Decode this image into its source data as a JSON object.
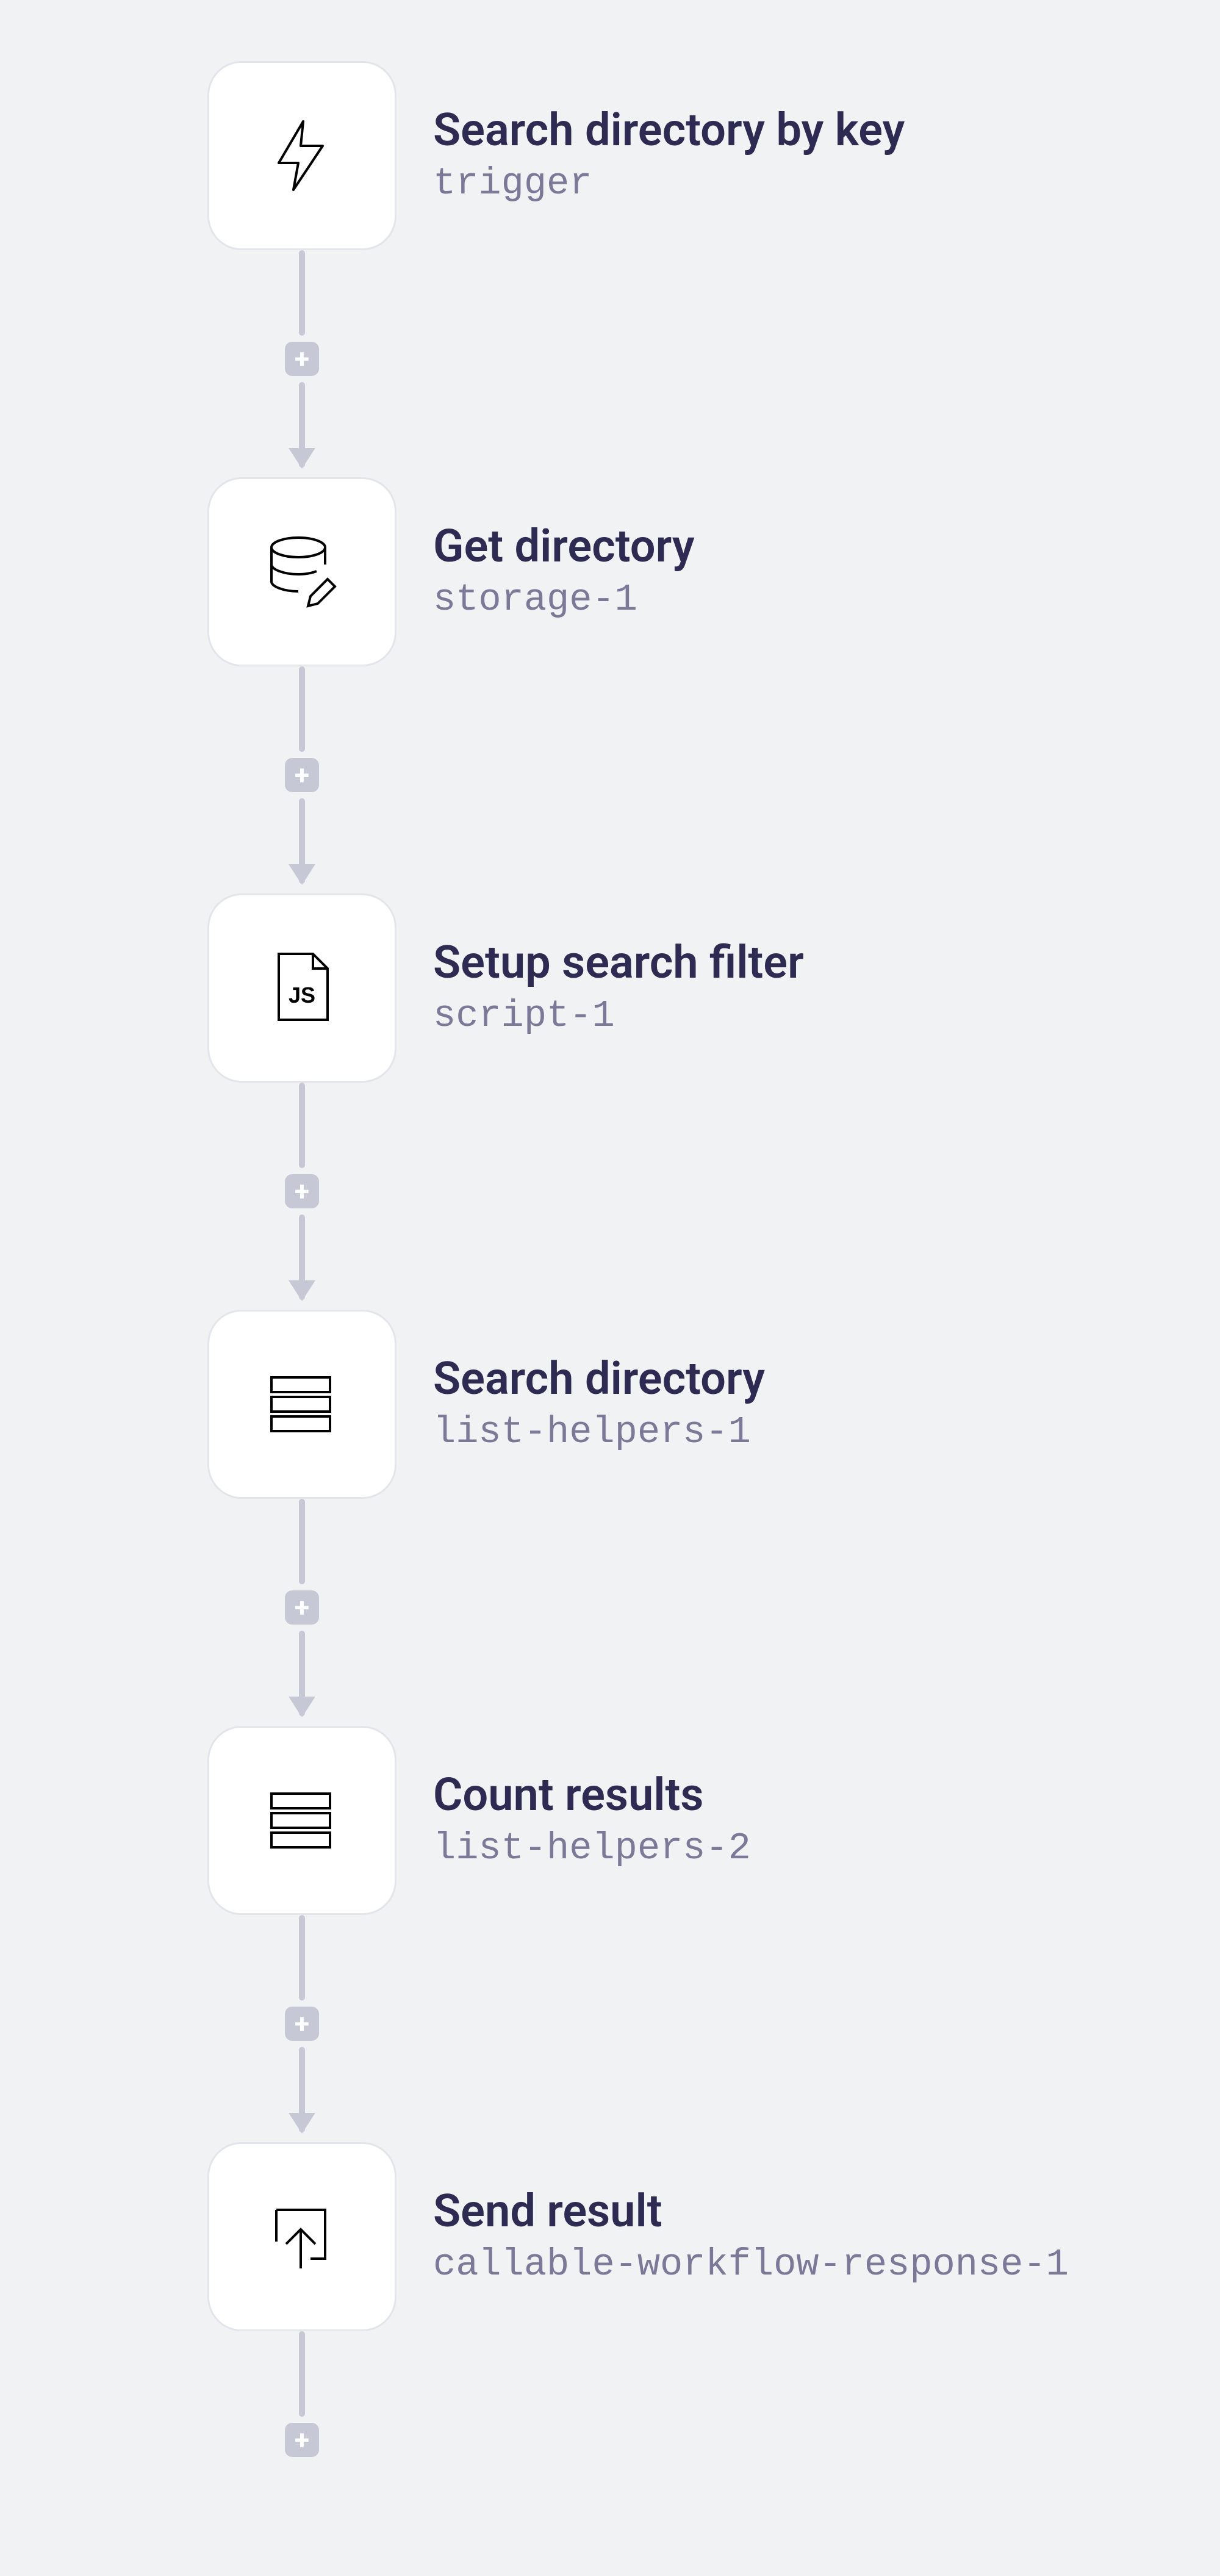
{
  "workflow": {
    "nodes": [
      {
        "title": "Search directory by key",
        "id": "trigger",
        "icon": "lightning-icon"
      },
      {
        "title": "Get directory",
        "id": "storage-1",
        "icon": "database-edit-icon"
      },
      {
        "title": "Setup search filter",
        "id": "script-1",
        "icon": "js-file-icon"
      },
      {
        "title": "Search directory",
        "id": "list-helpers-1",
        "icon": "list-icon"
      },
      {
        "title": "Count results",
        "id": "list-helpers-2",
        "icon": "list-icon"
      },
      {
        "title": "Send result",
        "id": "callable-workflow-response-1",
        "icon": "send-up-icon"
      }
    ]
  }
}
